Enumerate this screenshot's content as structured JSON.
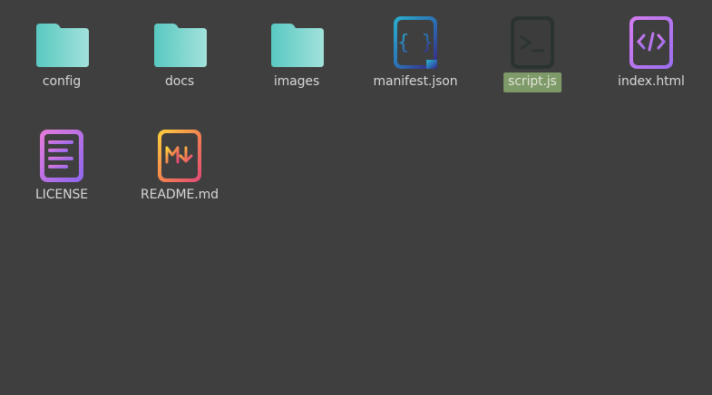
{
  "desktop": {
    "items": [
      {
        "label": "config",
        "icon": "folder-icon",
        "selected": false
      },
      {
        "label": "docs",
        "icon": "folder-icon",
        "selected": false
      },
      {
        "label": "images",
        "icon": "folder-icon",
        "selected": false
      },
      {
        "label": "manifest.json",
        "icon": "json-file-icon",
        "selected": false
      },
      {
        "label": "script.js",
        "icon": "script-file-icon",
        "selected": true
      },
      {
        "label": "index.html",
        "icon": "html-file-icon",
        "selected": false
      },
      {
        "label": "LICENSE",
        "icon": "license-file-icon",
        "selected": false
      },
      {
        "label": "README.md",
        "icon": "markdown-file-icon",
        "selected": false
      }
    ]
  },
  "colors": {
    "background": "#3f3f3f",
    "label_text": "#d7d7d7",
    "selection": "#7f9a69",
    "folder": "#5ec8c0",
    "json_gradient": [
      "#26a6c8",
      "#3a2080"
    ],
    "script_dark": "#2f3a34",
    "html_purple": "#b58af0",
    "license_gradient": [
      "#e07ad6",
      "#8f66ef"
    ],
    "markdown_gradient": [
      "#ffd33a",
      "#e34a74"
    ]
  }
}
